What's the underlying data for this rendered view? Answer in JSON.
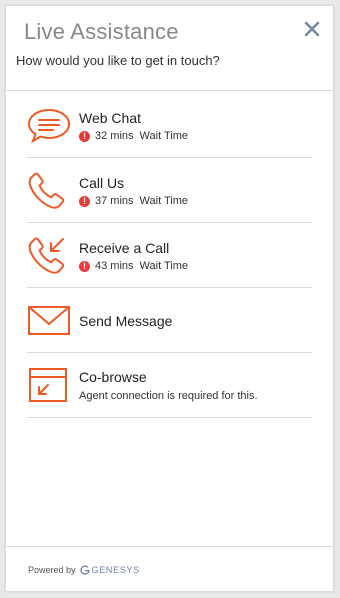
{
  "header": {
    "title": "Live Assistance",
    "subtitle": "How would you like to get in touch?"
  },
  "options": [
    {
      "label": "Web Chat",
      "wait_mins": "32 mins",
      "wait_label": "Wait Time"
    },
    {
      "label": "Call Us",
      "wait_mins": "37 mins",
      "wait_label": "Wait Time"
    },
    {
      "label": "Receive a Call",
      "wait_mins": "43 mins",
      "wait_label": "Wait Time"
    },
    {
      "label": "Send Message"
    },
    {
      "label": "Co-browse",
      "note": "Agent connection is required for this."
    }
  ],
  "footer": {
    "powered_by": "Powered by",
    "brand": "GENESYS"
  },
  "colors": {
    "accent": "#ee5a24",
    "alert": "#e43b3b",
    "close": "#7a8aa3"
  },
  "icons": [
    "chat-bubble-icon",
    "phone-icon",
    "phone-incoming-icon",
    "envelope-icon",
    "cobrowse-icon",
    "close-icon",
    "alert-icon"
  ]
}
